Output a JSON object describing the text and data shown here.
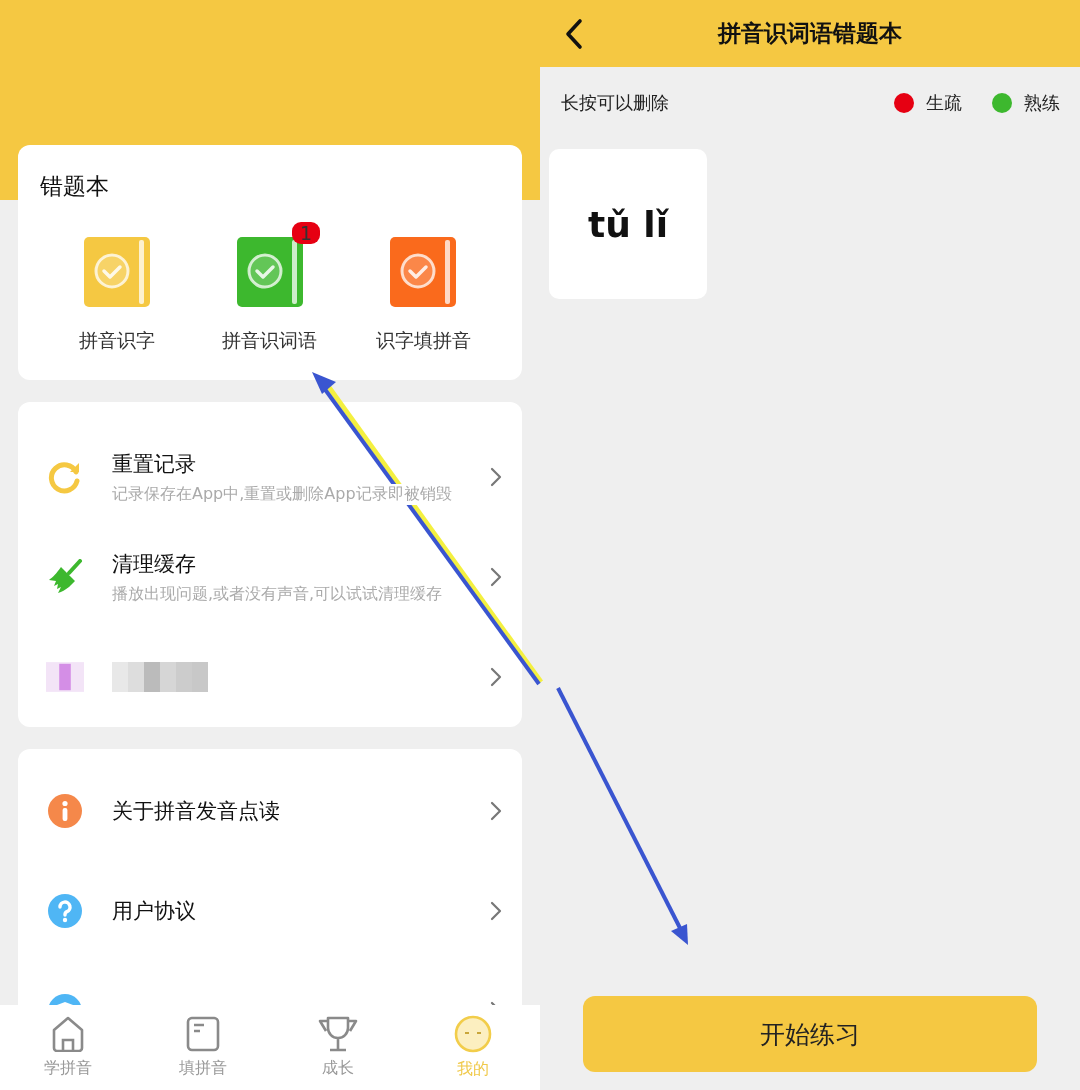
{
  "my_page": {
    "mistake_books": {
      "title": "错题本",
      "books": [
        {
          "label": "拼音识字",
          "color": "#f5c842"
        },
        {
          "label": "拼音识词语",
          "color": "#3db82e",
          "badge": "1"
        },
        {
          "label": "识字填拼音",
          "color": "#fa6a1c"
        }
      ]
    },
    "settings_group_1": [
      {
        "kind": "reset",
        "title": "重置记录",
        "subtitle": "记录保存在App中,重置或删除App记录即被销毁"
      },
      {
        "kind": "clean",
        "title": "清理缓存",
        "subtitle": "播放出现问题,或者没有声音,可以试试清理缓存"
      },
      {
        "kind": "blurred"
      }
    ],
    "settings_group_2": [
      {
        "kind": "info",
        "title": "关于拼音发音点读"
      },
      {
        "kind": "help",
        "title": "用户协议"
      },
      {
        "kind": "privacy"
      }
    ],
    "tab_bar": [
      {
        "kind": "home",
        "label": "学拼音",
        "selected": false
      },
      {
        "kind": "fill",
        "label": "填拼音",
        "selected": false
      },
      {
        "kind": "trophy",
        "label": "成长",
        "selected": false
      },
      {
        "kind": "me",
        "label": "我的",
        "selected": true
      }
    ]
  },
  "word_book_page": {
    "title": "拼音识词语错题本",
    "hint": "长按可以删除",
    "legend": [
      {
        "label": "生疏",
        "color": "#e60012"
      },
      {
        "label": "熟练",
        "color": "#3db82e"
      }
    ],
    "words": [
      {
        "pinyin": "tǔ lǐ"
      }
    ],
    "start_button": "开始练习"
  }
}
